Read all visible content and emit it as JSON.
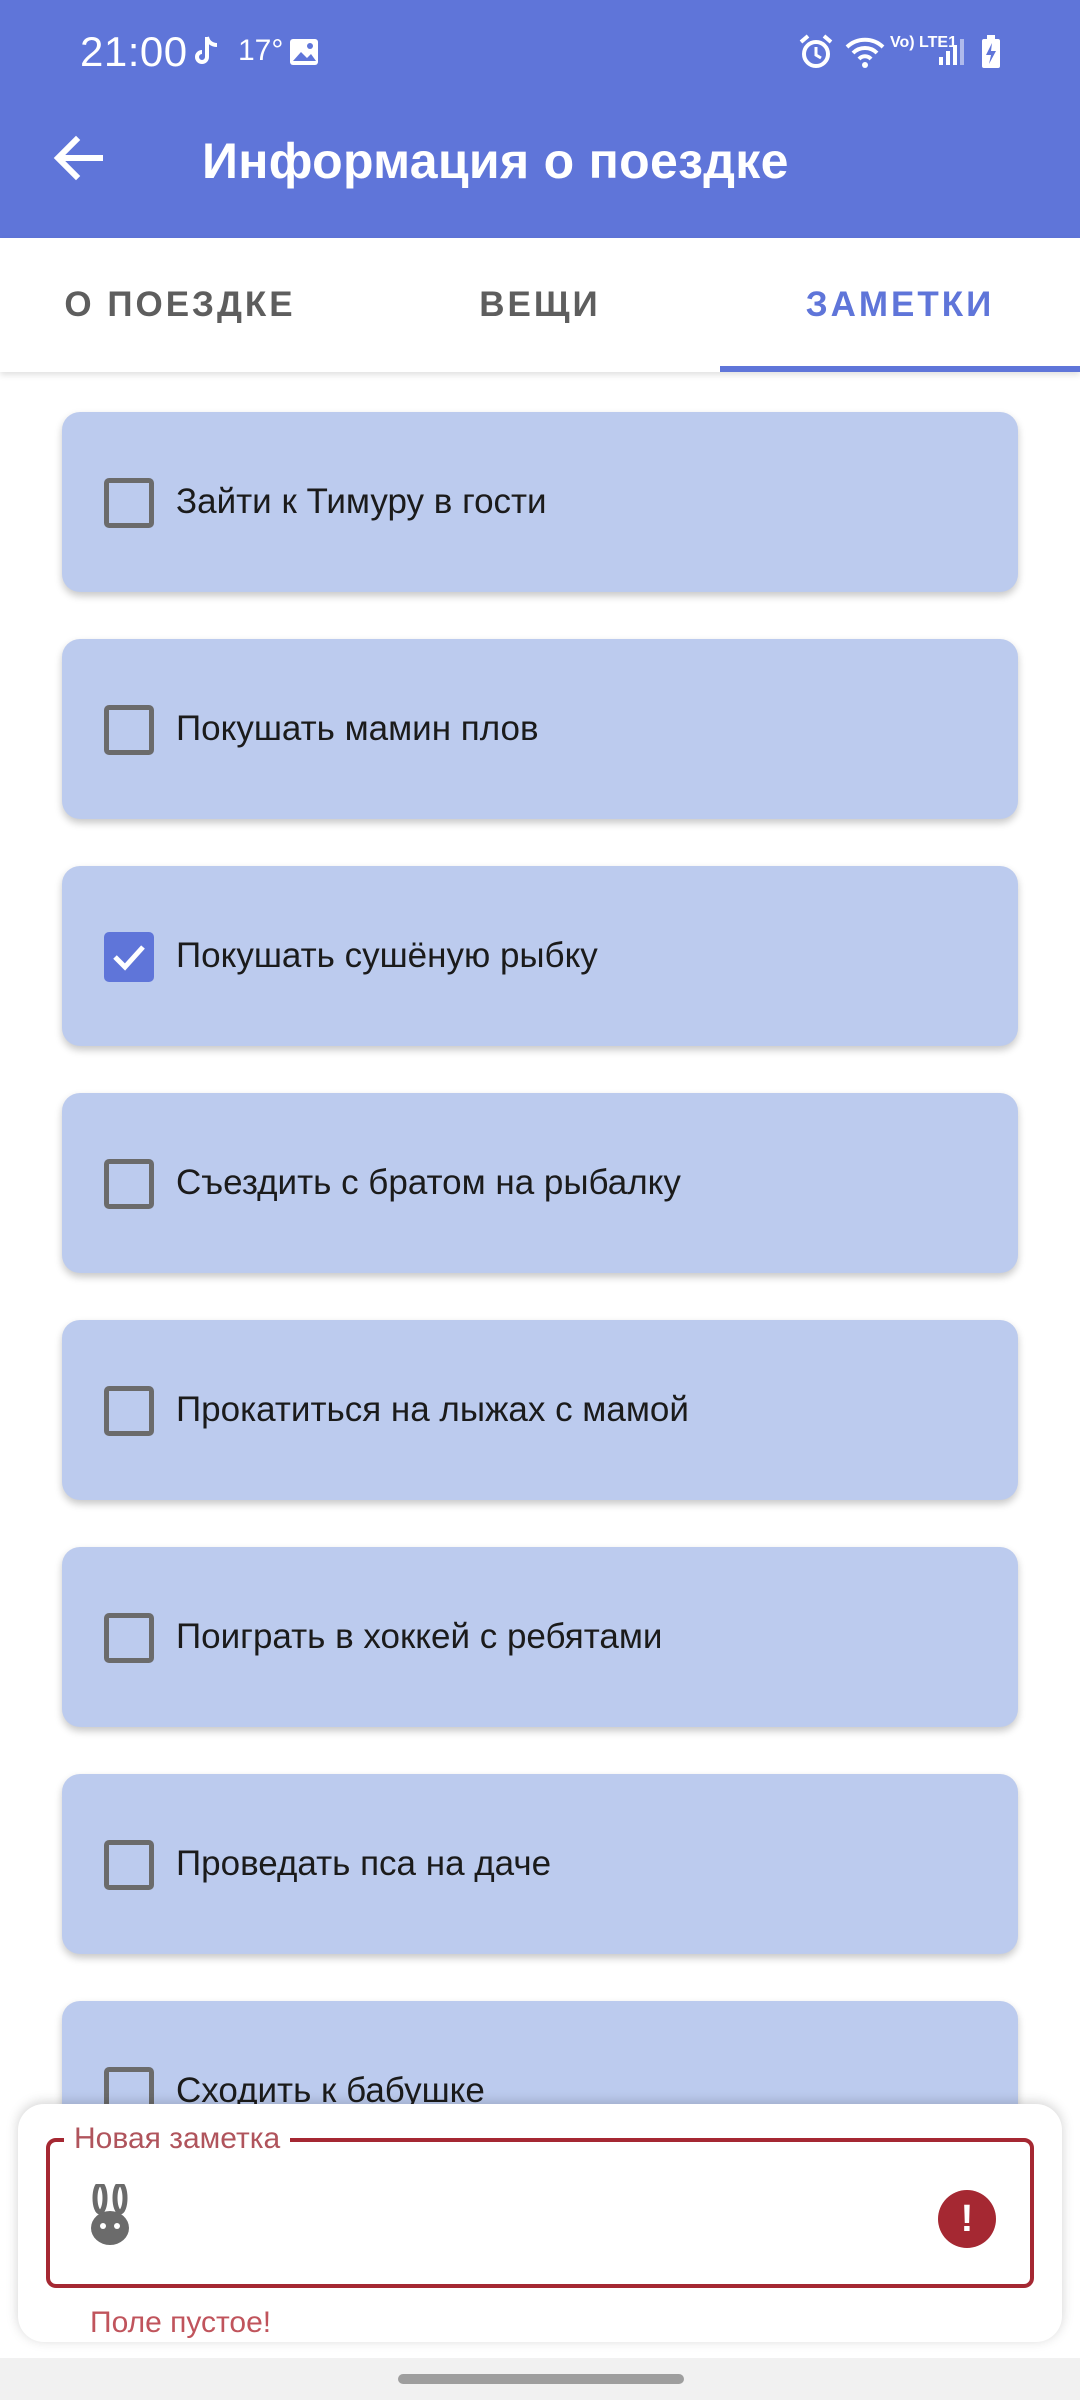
{
  "status_bar": {
    "time": "21:00",
    "temperature": "17°",
    "network_label": "Vo) LTE1"
  },
  "app_bar": {
    "title": "Информация о поездке",
    "back_icon": "arrow-left-icon"
  },
  "tabs": [
    {
      "label": "О ПОЕЗДКЕ",
      "active": false
    },
    {
      "label": "ВЕЩИ",
      "active": false
    },
    {
      "label": "ЗАМЕТКИ",
      "active": true
    }
  ],
  "notes": [
    {
      "text": "Зайти к Тимуру в гости",
      "checked": false
    },
    {
      "text": "Покушать мамин плов",
      "checked": false
    },
    {
      "text": "Покушать сушёную рыбку",
      "checked": true
    },
    {
      "text": "Съездить с братом на рыбалку",
      "checked": false
    },
    {
      "text": "Прокатиться на лыжах с мамой",
      "checked": false
    },
    {
      "text": "Поиграть в хоккей с ребятами",
      "checked": false
    },
    {
      "text": "Проведать пса на даче",
      "checked": false
    },
    {
      "text": "Сходить к бабушке",
      "checked": false
    }
  ],
  "new_note": {
    "label": "Новая заметка",
    "value": "",
    "error": "Поле пустое!",
    "error_icon": "!"
  },
  "colors": {
    "primary": "#5f75d9",
    "card": "#bccbee",
    "error": "#a52832"
  }
}
